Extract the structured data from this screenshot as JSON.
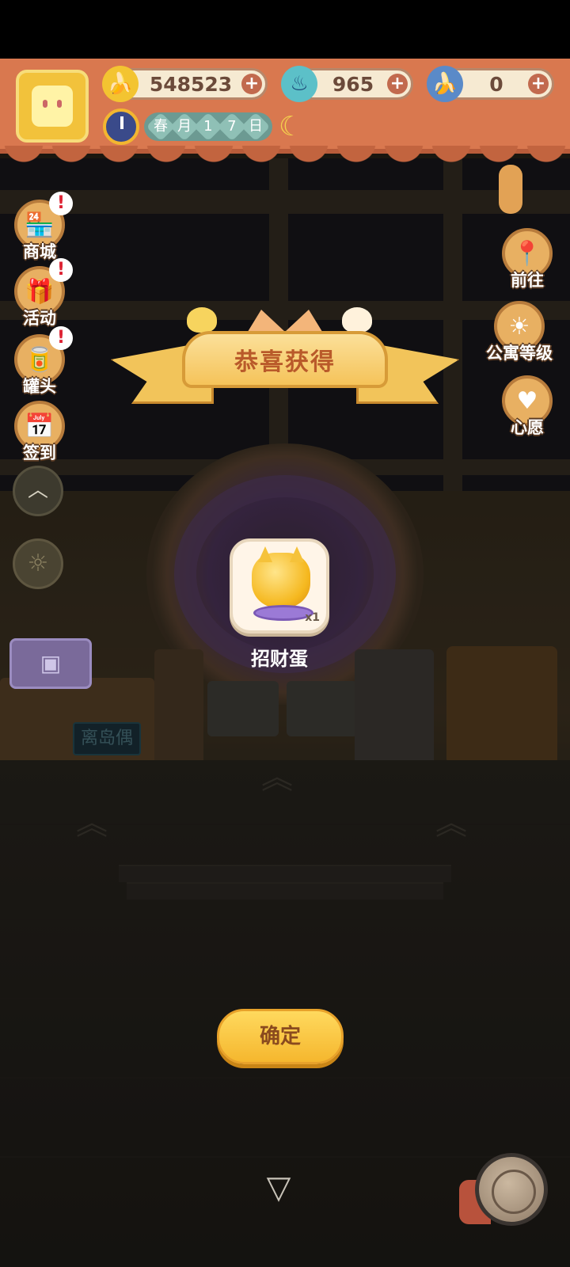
{
  "resources": {
    "bananas": "548523",
    "flames": "965",
    "blue_bananas": "0",
    "plus": "+"
  },
  "calendar": {
    "chars": [
      "春",
      "月",
      "1",
      "7",
      "日"
    ]
  },
  "side_left": {
    "shop": "商城",
    "event": "活动",
    "cans": "罐头",
    "checkin": "签到",
    "badge": "!"
  },
  "side_right": {
    "goto": "前往",
    "apartment_level": "公寓等级",
    "wish": "心愿"
  },
  "scene": {
    "sign": "离岛偶"
  },
  "popup": {
    "title": "恭喜获得",
    "item_name": "招财蛋",
    "item_qty": "x1",
    "confirm": "确定"
  },
  "icons": {
    "banana": "banana-icon",
    "flame": "flame-icon",
    "blue_banana": "blue-banana-icon",
    "clock": "clock-icon",
    "moon": "moon-icon",
    "up": "chevron-up-icon",
    "down": "chevron-down-icon",
    "yarn": "yarn-ball-icon"
  },
  "colors": {
    "header": "#d9784f",
    "ribbon": "#f5c35a",
    "confirm": "#f5b72e"
  }
}
